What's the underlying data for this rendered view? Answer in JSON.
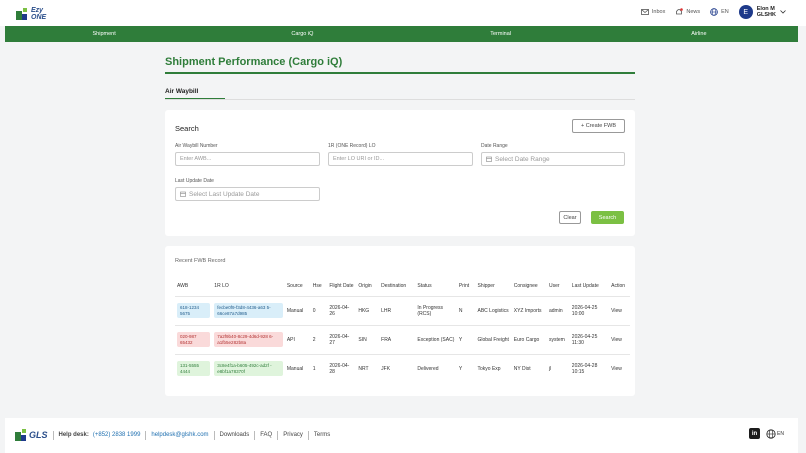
{
  "header": {
    "logo_line1": "Ezy",
    "logo_line2": "ONE",
    "inbox": "Inbox",
    "news": "News",
    "language": "EN",
    "avatar_initial": "E",
    "user_name": "Elon M",
    "user_org": "GLSHK"
  },
  "nav": [
    "Shipment",
    "Cargo iQ",
    "Terminal",
    "Airline"
  ],
  "page": {
    "title": "Shipment Performance (Cargo iQ)",
    "tab": "Air Waybill"
  },
  "search": {
    "title": "Search",
    "create_button": "+ Create FWB",
    "awb_label": "Air Waybill Number",
    "awb_placeholder": "Enter AWB...",
    "lo_label": "1R (ONE Record) LO",
    "lo_placeholder": "Enter LO URI or ID...",
    "date_label": "Date Range",
    "date_placeholder": "Select Date Range",
    "update_label": "Last Update Date",
    "update_placeholder": "Select Last Update Date",
    "clear_button": "Clear",
    "search_button": "Search"
  },
  "records": {
    "title": "Recent FWB Record",
    "columns": [
      "AWB",
      "1R LO",
      "Source",
      "Hse",
      "Flight Date",
      "Origin",
      "Destination",
      "Status",
      "Print",
      "Shipper",
      "Consignee",
      "User",
      "Last Update",
      "Action"
    ],
    "rows": [
      {
        "awb": "618-1234 5675",
        "lo": "fecbe0f9-f3d8-4436-a63 5-66ce87a7d985",
        "source": "Manual",
        "hse": "0",
        "flight_date": "2026-04-26",
        "origin": "HKG",
        "destination": "LHR",
        "status": "In Progress (RCS)",
        "print": "N",
        "shipper": "ABC Logistics",
        "consignee": "XYZ Imports",
        "user": "admin",
        "last_update": "2026-04-25 10:00",
        "action": "View",
        "tone": "blue"
      },
      {
        "awb": "020-987 65432",
        "lo": "7a2f9b40-8c29-4d6d-928 6-a1fb5e282b8a",
        "source": "API",
        "hse": "2",
        "flight_date": "2026-04-27",
        "origin": "SIN",
        "destination": "FRA",
        "status": "Exception (SAC)",
        "print": "Y",
        "shipper": "Global Freight",
        "consignee": "Euro Cargo",
        "user": "system",
        "last_update": "2026-04-25 11:30",
        "action": "View",
        "tone": "red"
      },
      {
        "awb": "131-5555 4444",
        "lo": "3c8e4f1a-b605-492c-ad2f -e8bf1a78370f",
        "source": "Manual",
        "hse": "1",
        "flight_date": "2026-04-28",
        "origin": "NRT",
        "destination": "JFK",
        "status": "Delivered",
        "print": "Y",
        "shipper": "Tokyo Exp",
        "consignee": "NY Dist",
        "user": "jl",
        "last_update": "2026-04-28 10:15",
        "action": "View",
        "tone": "green"
      }
    ]
  },
  "footer": {
    "brand": "GLS",
    "helpdesk_label": "Help desk:",
    "phone": "(+852) 2838 1999",
    "email": "helpdesk@glshk.com",
    "links": [
      "Downloads",
      "FAQ",
      "Privacy",
      "Terms"
    ],
    "language": "EN",
    "linkedin": "in"
  }
}
